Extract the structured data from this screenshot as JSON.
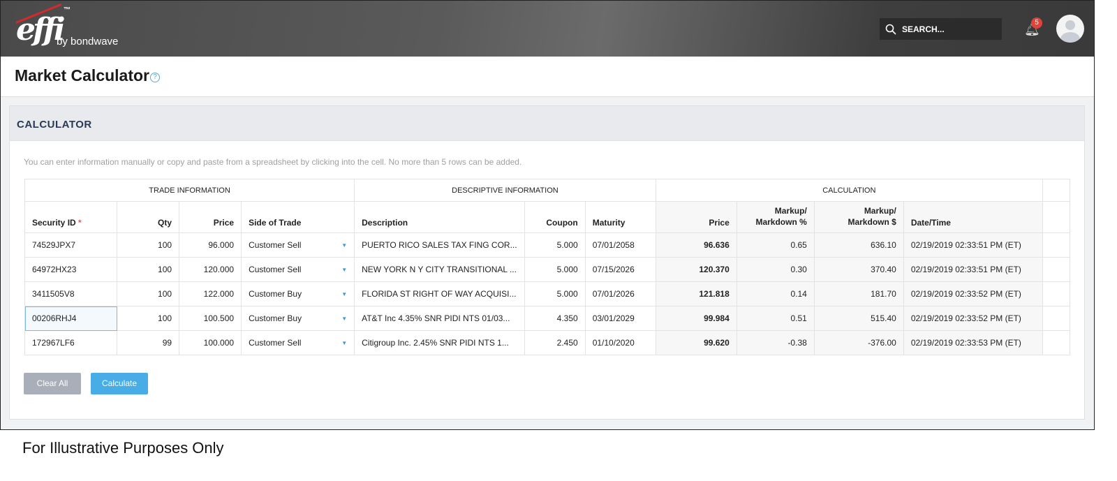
{
  "header": {
    "logo_text": "effi",
    "logo_tm": "™",
    "logo_by": "by bondwave",
    "search_placeholder": "SEARCH...",
    "notification_count": "5"
  },
  "page": {
    "title": "Market Calculator",
    "help": "?"
  },
  "calculator": {
    "heading": "CALCULATOR",
    "hint": "You can enter information manually or copy and paste from a spreadsheet by clicking into the cell. No more than 5 rows can be added.",
    "groups": [
      "TRADE INFORMATION",
      "DESCRIPTIVE INFORMATION",
      "CALCULATION"
    ],
    "columns": {
      "security_id": "Security ID",
      "required": "*",
      "qty": "Qty",
      "price": "Price",
      "side": "Side of Trade",
      "description": "Description",
      "coupon": "Coupon",
      "maturity": "Maturity",
      "calc_price": "Price",
      "markup_pct": "Markup/ Markdown %",
      "markup_usd": "Markup/ Markdown $",
      "datetime": "Date/Time"
    },
    "rows": [
      {
        "id": "74529JPX7",
        "qty": "100",
        "price": "96.000",
        "side": "Customer Sell",
        "desc": "PUERTO RICO SALES TAX FING COR...",
        "coupon": "5.000",
        "maturity": "07/01/2058",
        "cprice": "96.636",
        "pct": "0.65",
        "usd": "636.10",
        "dt": "02/19/2019 02:33:51 PM (ET)"
      },
      {
        "id": "64972HX23",
        "qty": "100",
        "price": "120.000",
        "side": "Customer Sell",
        "desc": "NEW YORK N Y CITY TRANSITIONAL ...",
        "coupon": "5.000",
        "maturity": "07/15/2026",
        "cprice": "120.370",
        "pct": "0.30",
        "usd": "370.40",
        "dt": "02/19/2019 02:33:51 PM (ET)"
      },
      {
        "id": "3411505V8",
        "qty": "100",
        "price": "122.000",
        "side": "Customer Buy",
        "desc": "FLORIDA ST RIGHT OF WAY ACQUISI...",
        "coupon": "5.000",
        "maturity": "07/01/2026",
        "cprice": "121.818",
        "pct": "0.14",
        "usd": "181.70",
        "dt": "02/19/2019 02:33:52 PM (ET)"
      },
      {
        "id": "00206RHJ4",
        "qty": "100",
        "price": "100.500",
        "side": "Customer Buy",
        "desc": "AT&T Inc 4.35% SNR PIDI NTS 01/03...",
        "coupon": "4.350",
        "maturity": "03/01/2029",
        "cprice": "99.984",
        "pct": "0.51",
        "usd": "515.40",
        "dt": "02/19/2019 02:33:52 PM (ET)"
      },
      {
        "id": "172967LF6",
        "qty": "99",
        "price": "100.000",
        "side": "Customer Sell",
        "desc": "Citigroup Inc. 2.45% SNR PIDI NTS 1...",
        "coupon": "2.450",
        "maturity": "01/10/2020",
        "cprice": "99.620",
        "pct": "-0.38",
        "usd": "-376.00",
        "dt": "02/19/2019 02:33:53 PM (ET)"
      }
    ],
    "clear_label": "Clear All",
    "calculate_label": "Calculate"
  },
  "caption": "For Illustrative Purposes Only"
}
